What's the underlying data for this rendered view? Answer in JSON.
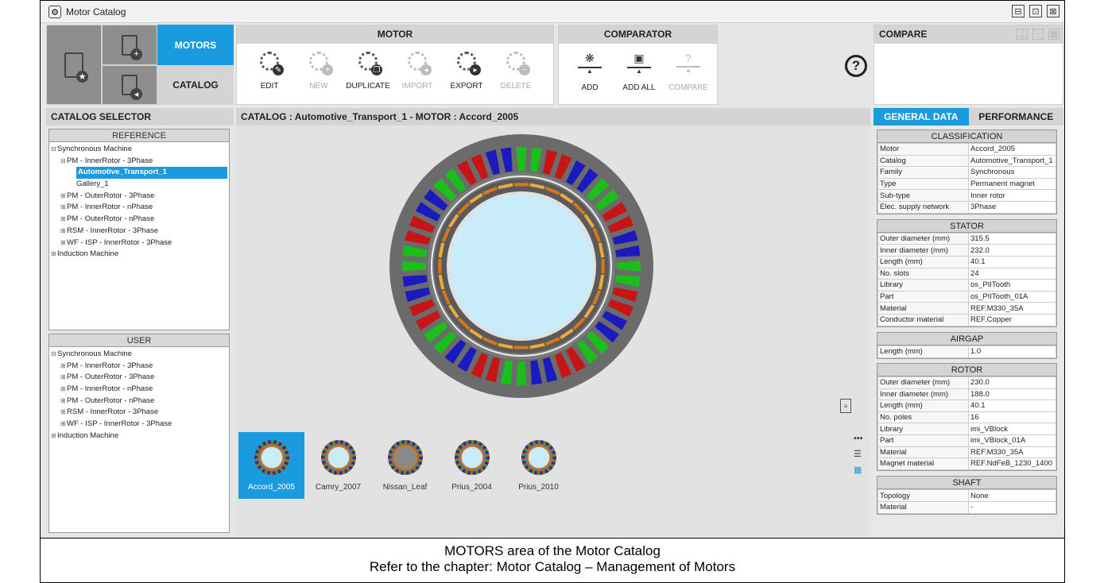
{
  "window": {
    "title": "Motor Catalog",
    "controls": [
      "⊟",
      "⊡",
      "⊠"
    ]
  },
  "nav": {
    "motors": "MOTORS",
    "catalog": "CATALOG"
  },
  "motor_toolbar": {
    "title": "MOTOR",
    "tools": [
      {
        "label": "EDIT",
        "enabled": true,
        "badge": "✎"
      },
      {
        "label": "NEW",
        "enabled": false,
        "badge": "+"
      },
      {
        "label": "DUPLICATE",
        "enabled": true,
        "badge": "❐"
      },
      {
        "label": "IMPORT",
        "enabled": false,
        "badge": "◂"
      },
      {
        "label": "EXPORT",
        "enabled": true,
        "badge": "▸"
      },
      {
        "label": "DELETE",
        "enabled": false,
        "badge": "−"
      }
    ]
  },
  "comparator_toolbar": {
    "title": "COMPARATOR",
    "tools": [
      {
        "label": "ADD",
        "enabled": true,
        "glyph": "❋"
      },
      {
        "label": "ADD ALL",
        "enabled": true,
        "glyph": "▣"
      },
      {
        "label": "COMPARE",
        "enabled": false,
        "glyph": "?"
      }
    ]
  },
  "help": {
    "glyph": "?"
  },
  "compare": {
    "title": "COMPARE",
    "icons": [
      "⍊",
      "−",
      "▥"
    ]
  },
  "catalog_selector": {
    "title": "CATALOG SELECTOR",
    "reference": {
      "title": "REFERENCE",
      "nodes": [
        {
          "label": "Synchronous Machine",
          "exp": "⊟",
          "indent": 0
        },
        {
          "label": "PM - InnerRotor - 3Phase",
          "exp": "⊟",
          "indent": 1
        },
        {
          "label": "Automotive_Transport_1",
          "exp": "",
          "indent": 2,
          "selected": true
        },
        {
          "label": "Gallery_1",
          "exp": "",
          "indent": 2
        },
        {
          "label": "PM - OuterRotor - 3Phase",
          "exp": "⊞",
          "indent": 1
        },
        {
          "label": "PM - InnerRotor - nPhase",
          "exp": "⊞",
          "indent": 1
        },
        {
          "label": "PM - OuterRotor - nPhase",
          "exp": "⊞",
          "indent": 1
        },
        {
          "label": "RSM - InnerRotor - 3Phase",
          "exp": "⊞",
          "indent": 1
        },
        {
          "label": "WF - ISP - InnerRotor - 3Phase",
          "exp": "⊞",
          "indent": 1
        },
        {
          "label": "Induction Machine",
          "exp": "⊞",
          "indent": 0
        }
      ]
    },
    "user": {
      "title": "USER",
      "nodes": [
        {
          "label": "Synchronous Machine",
          "exp": "⊟",
          "indent": 0
        },
        {
          "label": "PM - InnerRotor - 3Phase",
          "exp": "⊞",
          "indent": 1
        },
        {
          "label": "PM - OuterRotor - 3Phase",
          "exp": "⊞",
          "indent": 1
        },
        {
          "label": "PM - InnerRotor - nPhase",
          "exp": "⊞",
          "indent": 1
        },
        {
          "label": "PM - OuterRotor - nPhase",
          "exp": "⊞",
          "indent": 1
        },
        {
          "label": "RSM - InnerRotor - 3Phase",
          "exp": "⊞",
          "indent": 1
        },
        {
          "label": "WF - ISP - InnerRotor - 3Phase",
          "exp": "⊞",
          "indent": 1
        },
        {
          "label": "Induction Machine",
          "exp": "⊞",
          "indent": 0
        }
      ]
    }
  },
  "center": {
    "header": "CATALOG : Automotive_Transport_1  -  MOTOR : Accord_2005",
    "motor": {
      "slots": 24,
      "poles": 16,
      "colors": {
        "stator": "#6b6b6b",
        "bore": "#c8ecfa",
        "rotor_ring": "#5a5a5a",
        "magnet": "#f2a83a",
        "magnet_dark": "#d9771a",
        "phase_a": "#1abf1a",
        "phase_b": "#c81414",
        "phase_c": "#1a1abf"
      }
    },
    "thumbnails": [
      {
        "label": "Accord_2005",
        "active": true
      },
      {
        "label": "Camry_2007",
        "active": false
      },
      {
        "label": "Nissan_Leaf",
        "active": false
      },
      {
        "label": "Prius_2004",
        "active": false
      },
      {
        "label": "Prius_2010",
        "active": false
      }
    ],
    "view_icons": [
      "▪▪▪",
      "☰",
      "▦"
    ],
    "doc_glyph": "≡"
  },
  "right": {
    "tabs": [
      {
        "label": "GENERAL DATA",
        "active": true
      },
      {
        "label": "PERFORMANCE",
        "active": false
      }
    ],
    "sections": [
      {
        "title": "CLASSIFICATION",
        "rows": [
          [
            "Motor",
            "Accord_2005"
          ],
          [
            "Catalog",
            "Automotive_Transport_1"
          ],
          [
            "Family",
            "Synchronous"
          ],
          [
            "Type",
            "Permanent magnet"
          ],
          [
            "Sub-type",
            "Inner rotor"
          ],
          [
            "Elec. supply network",
            "3Phase"
          ]
        ]
      },
      {
        "title": "STATOR",
        "rows": [
          [
            "Outer diameter (mm)",
            "315.5"
          ],
          [
            "Inner diameter (mm)",
            "232.0"
          ],
          [
            "Length (mm)",
            "40.1"
          ],
          [
            "No. slots",
            "24"
          ],
          [
            "Library",
            "os_PIITooth"
          ],
          [
            "Part",
            "os_PIITooth_01A"
          ],
          [
            "Material",
            "REF.M330_35A"
          ],
          [
            "Conductor material",
            "REF.Copper"
          ]
        ]
      },
      {
        "title": "AIRGAP",
        "rows": [
          [
            "Length (mm)",
            "1.0"
          ]
        ]
      },
      {
        "title": "ROTOR",
        "rows": [
          [
            "Outer diameter (mm)",
            "230.0"
          ],
          [
            "Inner diameter (mm)",
            "188.0"
          ],
          [
            "Length (mm)",
            "40.1"
          ],
          [
            "No. poles",
            "16"
          ],
          [
            "Library",
            "imi_VBlock"
          ],
          [
            "Part",
            "imi_VBlock_01A"
          ],
          [
            "Material",
            "REF.M330_35A"
          ],
          [
            "Magnet material",
            "REF.NdFeB_1230_1400"
          ]
        ]
      },
      {
        "title": "SHAFT",
        "rows": [
          [
            "Topology",
            "None"
          ],
          [
            "Material",
            "-"
          ]
        ]
      }
    ]
  },
  "caption": {
    "line1": "MOTORS area of the Motor Catalog",
    "line2": "Refer to the chapter: Motor Catalog – Management of Motors"
  }
}
